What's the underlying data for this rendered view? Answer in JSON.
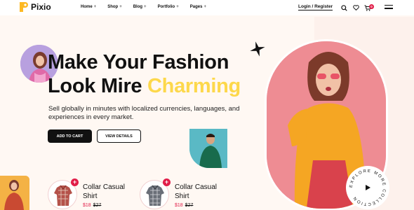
{
  "brand": {
    "name": "Pixio",
    "accent": "#fdd84b"
  },
  "nav": {
    "items": [
      {
        "label": "Home",
        "icon": "plus-icon"
      },
      {
        "label": "Shop",
        "icon": "plus-icon"
      },
      {
        "label": "Blog",
        "icon": "plus-icon"
      },
      {
        "label": "Portfolio",
        "icon": "plus-icon"
      },
      {
        "label": "Pages",
        "icon": "plus-icon"
      }
    ],
    "login": "Login / Register",
    "cart_count": "0"
  },
  "hero": {
    "headline_line1": "Make Your Fashion",
    "headline_line2_prefix": "Look Mire ",
    "headline_accent": "Charming",
    "subtext": "Sell globally in minutes with localized currencies, languages, and experiences in every market.",
    "primary_button": "ADD TO CART",
    "secondary_button": "VIEW DETAILS",
    "badge_text": "EXPLORE MORE COLLECTION"
  },
  "products": [
    {
      "name": "Collar Casual Shirt",
      "price": "$18",
      "old_price": "$27"
    },
    {
      "name": "Collar Casual Shirt",
      "price": "$18",
      "old_price": "$27"
    }
  ]
}
